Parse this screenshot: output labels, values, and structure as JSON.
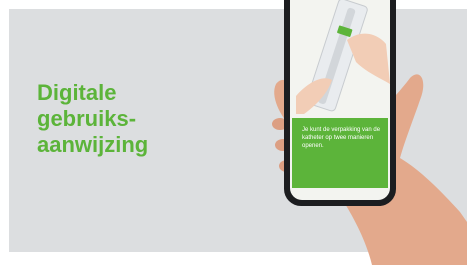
{
  "headline": {
    "line1": "Digitale",
    "line2": "gebruiks-",
    "line3": "aanwijzing"
  },
  "phone_screen": {
    "caption": "Je kunt de verpakking van de katheter op twee manieren openen."
  },
  "colors": {
    "banner_bg": "#dcdee0",
    "accent_green": "#5cb43a",
    "phone_frame": "#1c1d20",
    "screen_light": "#f3f4f0"
  }
}
